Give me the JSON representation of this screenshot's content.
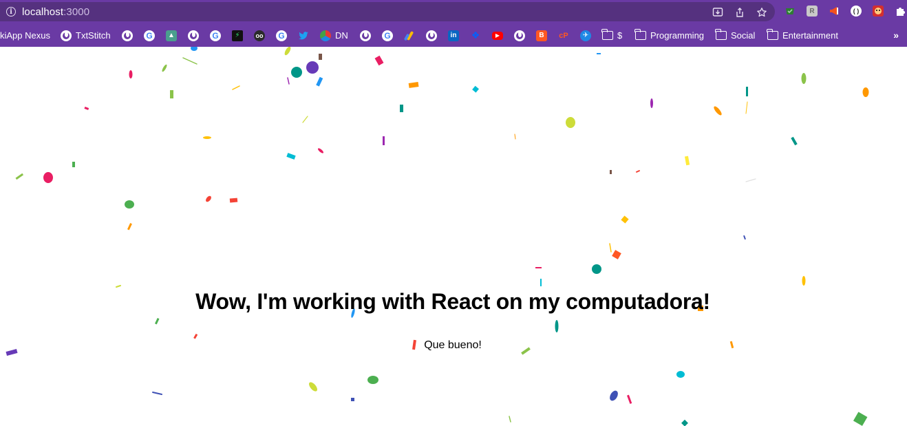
{
  "browser": {
    "url_host": "localhost",
    "url_port": ":3000",
    "bookmarks": [
      {
        "label": "kiApp Nexus",
        "icon": "none"
      },
      {
        "label": "TxtStitch",
        "icon": "globe-icon"
      },
      {
        "label": "",
        "icon": "globe-icon"
      },
      {
        "label": "",
        "icon": "google-icon"
      },
      {
        "label": "",
        "icon": "app-icon"
      },
      {
        "label": "",
        "icon": "globe-icon"
      },
      {
        "label": "",
        "icon": "google-icon"
      },
      {
        "label": "",
        "icon": "app-icon"
      },
      {
        "label": "",
        "icon": "owl-icon"
      },
      {
        "label": "",
        "icon": "google-icon"
      },
      {
        "label": "",
        "icon": "twitter-icon"
      },
      {
        "label": "DN",
        "icon": "dn-icon"
      },
      {
        "label": "",
        "icon": "globe-icon"
      },
      {
        "label": "",
        "icon": "google-icon"
      },
      {
        "label": "",
        "icon": "ads-icon"
      },
      {
        "label": "",
        "icon": "globe-icon"
      },
      {
        "label": "",
        "icon": "linkedin-icon"
      },
      {
        "label": "",
        "icon": "dropbox-icon"
      },
      {
        "label": "",
        "icon": "youtube-icon"
      },
      {
        "label": "",
        "icon": "globe-icon"
      },
      {
        "label": "",
        "icon": "blogger-icon"
      },
      {
        "label": "",
        "icon": "app-icon"
      },
      {
        "label": "",
        "icon": "app-icon"
      },
      {
        "label": "$",
        "icon": "folder-icon"
      },
      {
        "label": "Programming",
        "icon": "folder-icon"
      },
      {
        "label": "Social",
        "icon": "folder-icon"
      },
      {
        "label": "Entertainment",
        "icon": "folder-icon"
      }
    ],
    "overflow_label": "»",
    "colors": {
      "frame": "#6a3aa4",
      "omnibox": "#55317f"
    }
  },
  "page": {
    "title": "Wow, I'm working with React on my computadora!",
    "subtitle": "Que bueno!"
  }
}
